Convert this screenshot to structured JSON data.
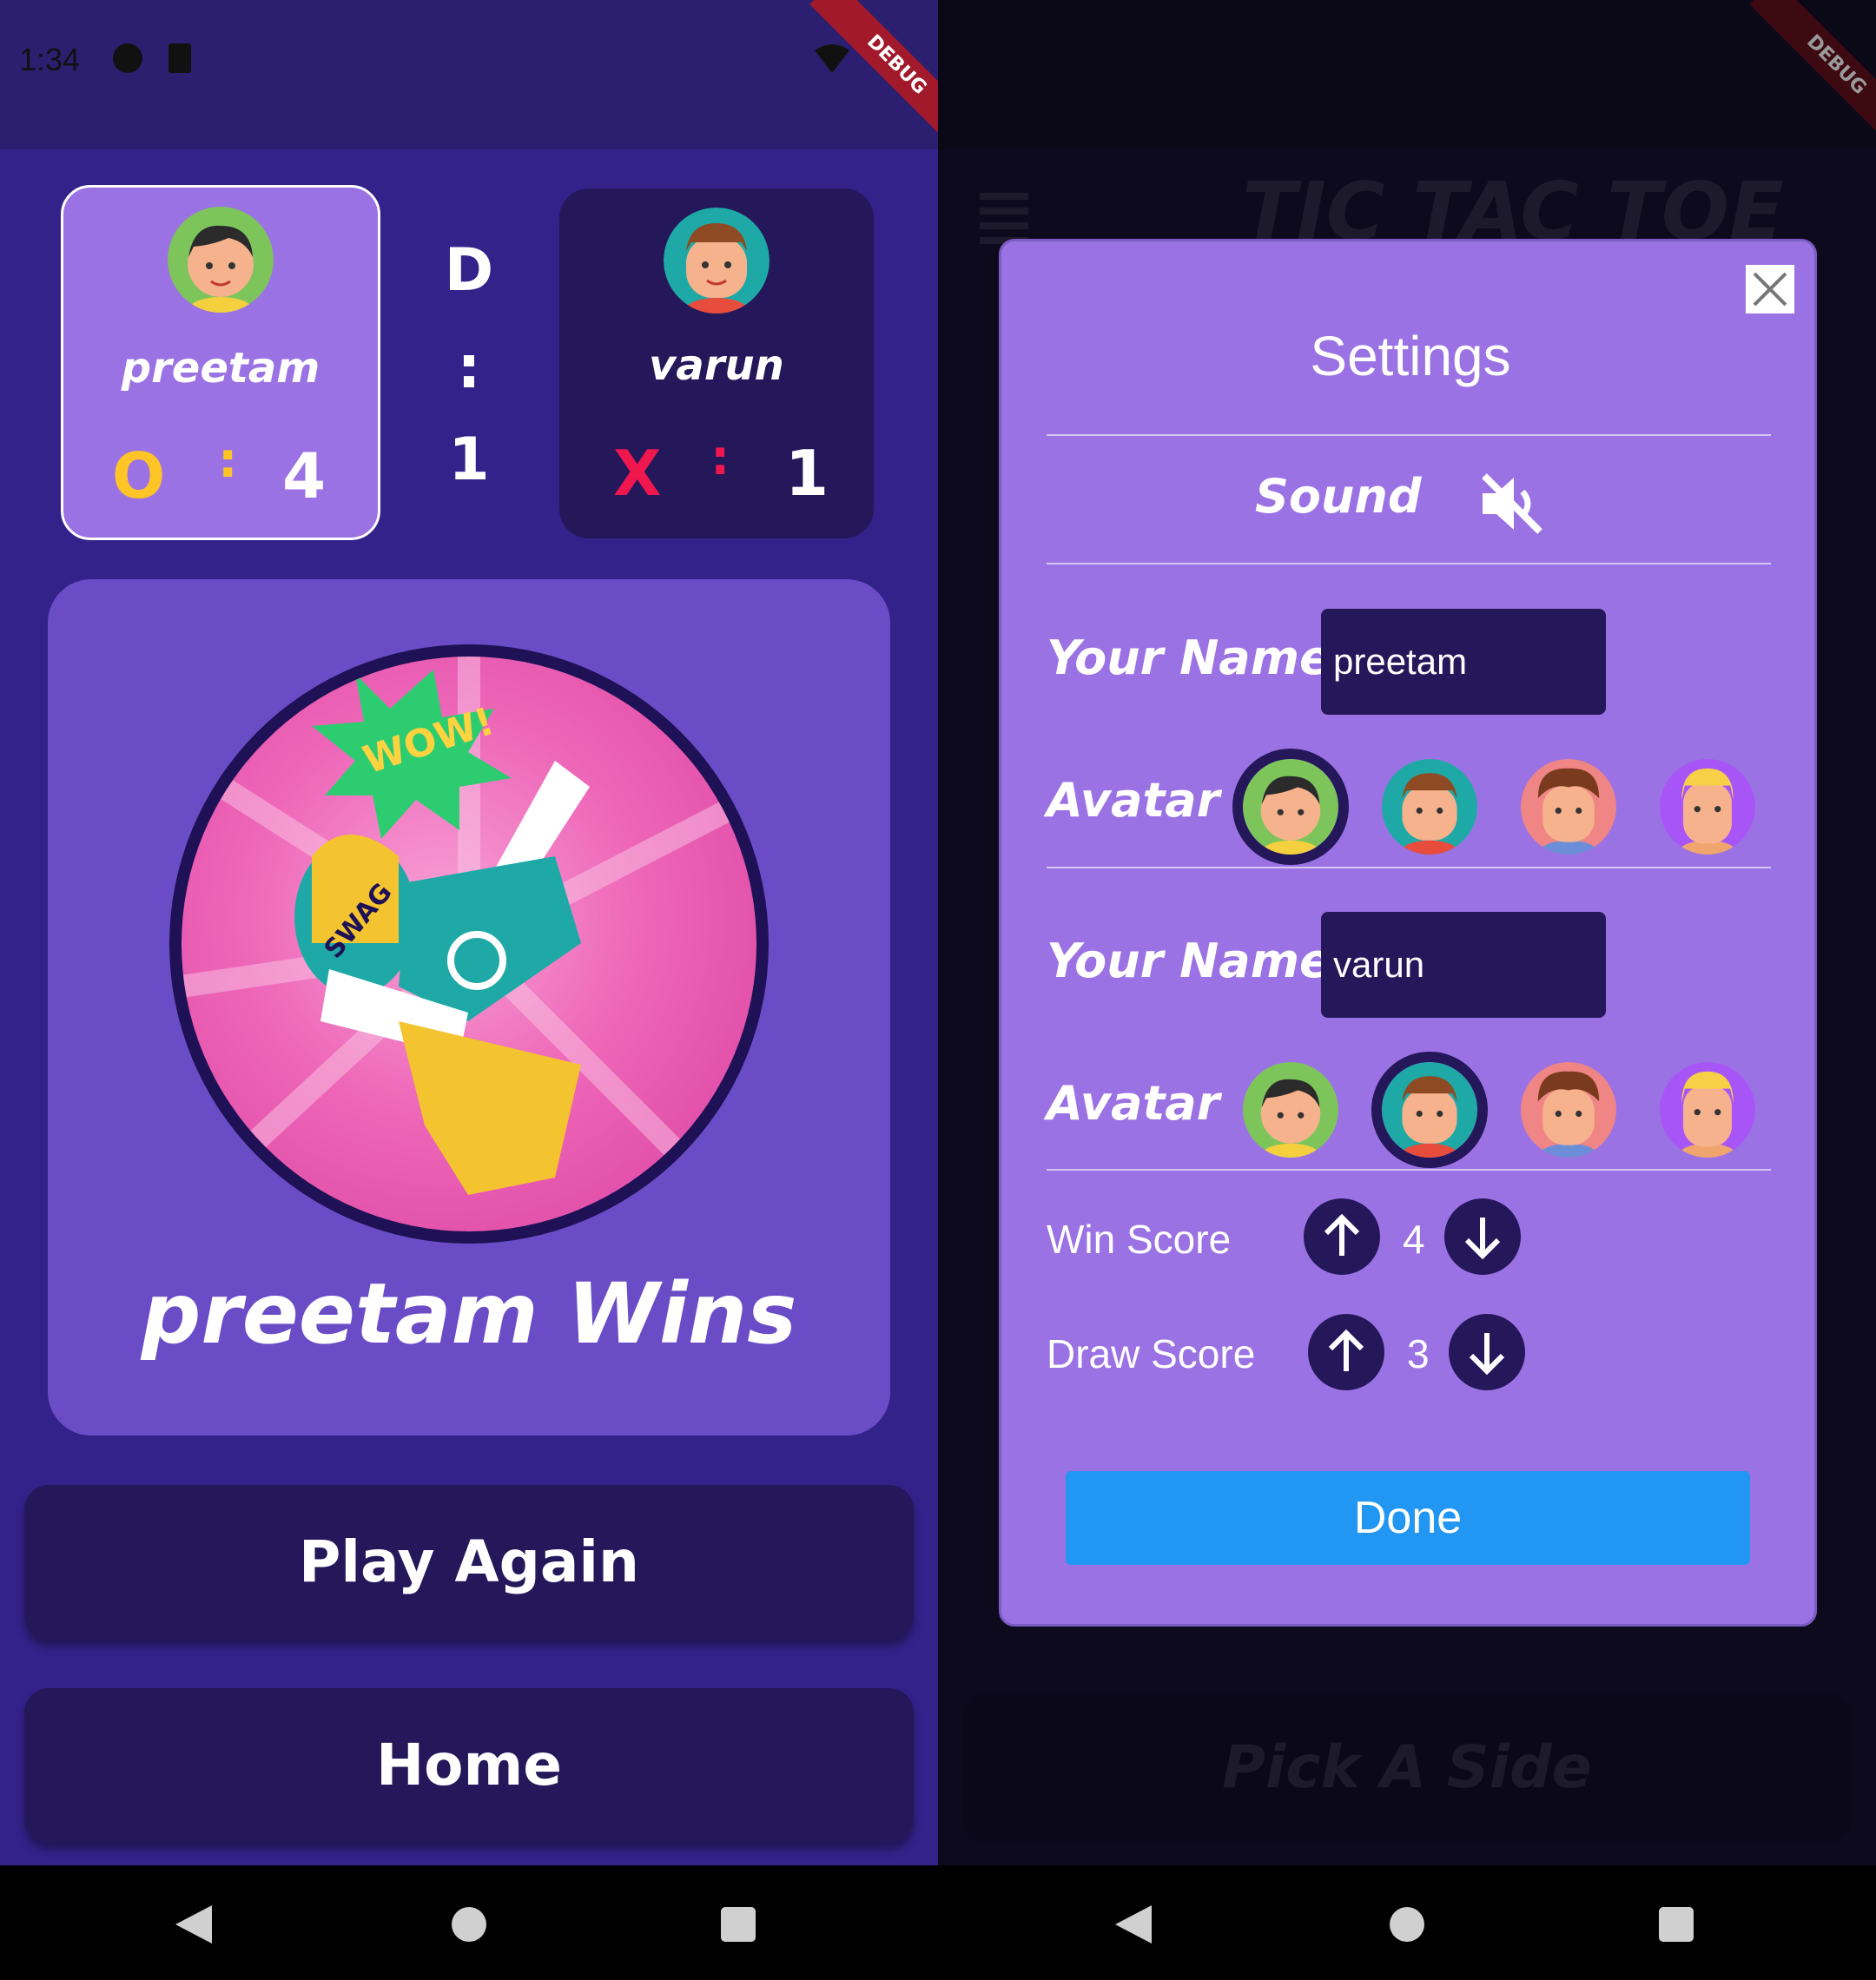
{
  "left": {
    "status_time": "1:34",
    "debug_label": "DEBUG",
    "player1": {
      "name": "preetam",
      "symbol": "O",
      "sep": ":",
      "score": "4"
    },
    "draw": {
      "letter": "D",
      "sep": ":",
      "score": "1"
    },
    "player2": {
      "name": "varun",
      "symbol": "X",
      "sep": ":",
      "score": "1"
    },
    "winner_text": "preetam Wins",
    "play_again_label": "Play Again",
    "home_label": "Home"
  },
  "right": {
    "debug_label": "DEBUG",
    "bg_title": "TIC TAC TOE",
    "bg_pick_side": "Pick A Side",
    "settings": {
      "title": "Settings",
      "sound_label": "Sound",
      "player1": {
        "name_label": "Your Name",
        "name_value": "preetam",
        "avatar_label": "Avatar",
        "selected_avatar": 0
      },
      "player2": {
        "name_label": "Your Name",
        "name_value": "varun",
        "avatar_label": "Avatar",
        "selected_avatar": 1
      },
      "win_score_label": "Win Score",
      "win_score_value": "4",
      "draw_score_label": "Draw Score",
      "draw_score_value": "3",
      "done_label": "Done"
    }
  },
  "colors": {
    "o_symbol": "#ffc526",
    "x_symbol": "#f0174f",
    "accent_blue": "#2196f3",
    "dialog_bg": "#9b72e3",
    "dark_panel": "#24175a"
  }
}
